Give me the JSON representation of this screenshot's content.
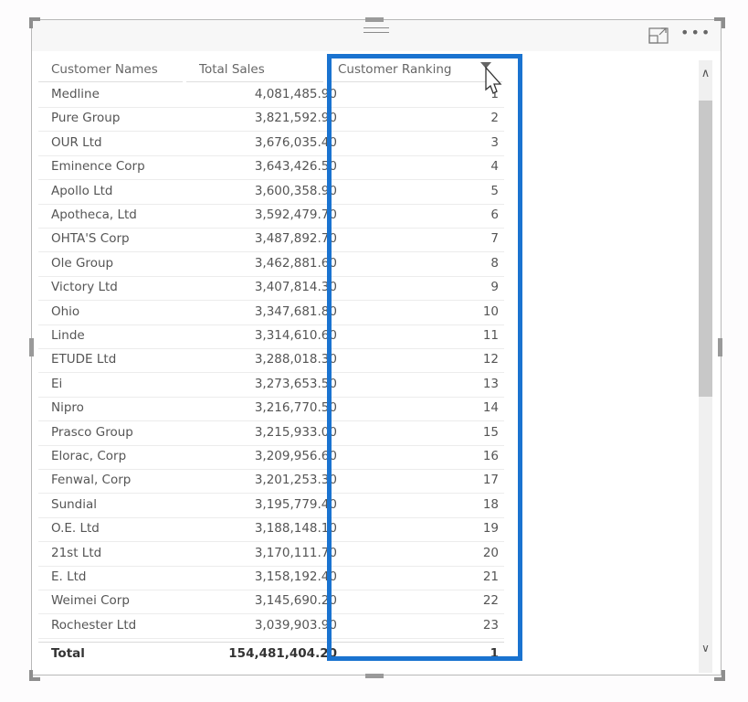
{
  "visual": {
    "more_options_label": "•••",
    "icons": {
      "focus": "focus-mode-icon",
      "more": "more-options-icon",
      "drag": "drag-grip-icon",
      "sort": "sort-descending-icon",
      "cursor": "mouse-pointer-icon"
    }
  },
  "table": {
    "columns": [
      "Customer Names",
      "Total Sales",
      "Customer Ranking"
    ],
    "rows": [
      {
        "name": "Medline",
        "sales": "4,081,485.90",
        "rank": "1"
      },
      {
        "name": "Pure Group",
        "sales": "3,821,592.90",
        "rank": "2"
      },
      {
        "name": "OUR Ltd",
        "sales": "3,676,035.40",
        "rank": "3"
      },
      {
        "name": "Eminence Corp",
        "sales": "3,643,426.50",
        "rank": "4"
      },
      {
        "name": "Apollo Ltd",
        "sales": "3,600,358.90",
        "rank": "5"
      },
      {
        "name": "Apotheca, Ltd",
        "sales": "3,592,479.70",
        "rank": "6"
      },
      {
        "name": "OHTA'S Corp",
        "sales": "3,487,892.70",
        "rank": "7"
      },
      {
        "name": "Ole Group",
        "sales": "3,462,881.60",
        "rank": "8"
      },
      {
        "name": "Victory Ltd",
        "sales": "3,407,814.30",
        "rank": "9"
      },
      {
        "name": "Ohio",
        "sales": "3,347,681.80",
        "rank": "10"
      },
      {
        "name": "Linde",
        "sales": "3,314,610.60",
        "rank": "11"
      },
      {
        "name": "ETUDE Ltd",
        "sales": "3,288,018.30",
        "rank": "12"
      },
      {
        "name": "Ei",
        "sales": "3,273,653.50",
        "rank": "13"
      },
      {
        "name": "Nipro",
        "sales": "3,216,770.50",
        "rank": "14"
      },
      {
        "name": "Prasco Group",
        "sales": "3,215,933.00",
        "rank": "15"
      },
      {
        "name": "Elorac, Corp",
        "sales": "3,209,956.60",
        "rank": "16"
      },
      {
        "name": "Fenwal, Corp",
        "sales": "3,201,253.30",
        "rank": "17"
      },
      {
        "name": "Sundial",
        "sales": "3,195,779.40",
        "rank": "18"
      },
      {
        "name": "O.E. Ltd",
        "sales": "3,188,148.10",
        "rank": "19"
      },
      {
        "name": "21st Ltd",
        "sales": "3,170,111.70",
        "rank": "20"
      },
      {
        "name": "E. Ltd",
        "sales": "3,158,192.40",
        "rank": "21"
      },
      {
        "name": "Weimei Corp",
        "sales": "3,145,690.20",
        "rank": "22"
      },
      {
        "name": "Rochester Ltd",
        "sales": "3,039,903.90",
        "rank": "23"
      }
    ],
    "total": {
      "label": "Total",
      "sales": "154,481,404.20",
      "rank": "1"
    }
  },
  "scrollbar": {
    "up_label": "∧",
    "down_label": "∨",
    "position_fraction": 0
  },
  "highlight_color": "#1a73d0"
}
